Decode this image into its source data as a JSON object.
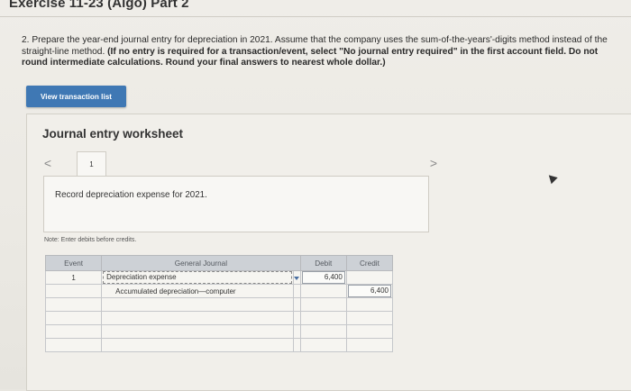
{
  "exercise": {
    "title": "Exercise 11-23 (Algo) Part 2"
  },
  "instructions": {
    "lead": "2. Prepare the year-end journal entry for depreciation in 2021. Assume that the company uses the sum-of-the-years'-digits method instead of the straight-line method. ",
    "bold": "(If no entry is required for a transaction/event, select \"No journal entry required\" in the first account field. Do not round intermediate calculations. Round your final answers to nearest whole dollar.)"
  },
  "view_transaction_list": "View transaction list",
  "worksheet": {
    "title": "Journal entry worksheet",
    "nav_prev": "<",
    "nav_next": ">",
    "tab_number": "1",
    "record_text": "Record depreciation expense for 2021.",
    "note": "Note: Enter debits before credits."
  },
  "journal": {
    "headers": {
      "event": "Event",
      "general_journal": "General Journal",
      "debit": "Debit",
      "credit": "Credit"
    },
    "rows": [
      {
        "event": "1",
        "account": "Depreciation expense",
        "debit": "6,400",
        "credit": ""
      },
      {
        "event": "",
        "account": "Accumulated depreciation—computer",
        "debit": "",
        "credit": "6,400"
      },
      {
        "event": "",
        "account": "",
        "debit": "",
        "credit": ""
      },
      {
        "event": "",
        "account": "",
        "debit": "",
        "credit": ""
      },
      {
        "event": "",
        "account": "",
        "debit": "",
        "credit": ""
      },
      {
        "event": "",
        "account": "",
        "debit": "",
        "credit": ""
      }
    ]
  }
}
